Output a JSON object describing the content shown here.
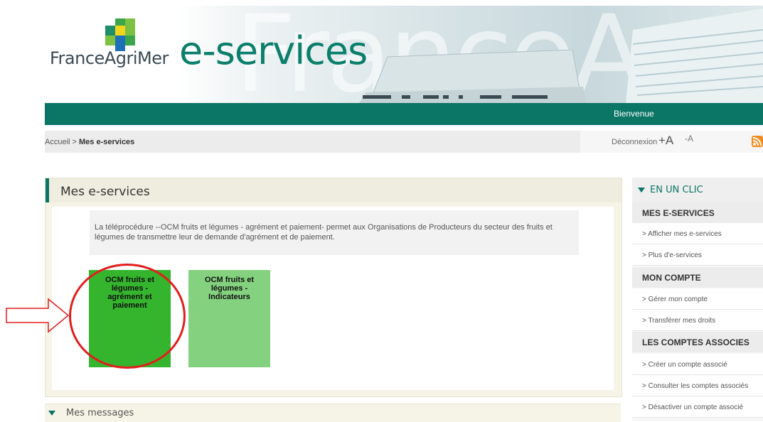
{
  "header": {
    "logo_text": "FranceAgriMer",
    "title": "e-services",
    "ghost_text": "FranceAgriMer"
  },
  "nav": {
    "welcome": "Bienvenue"
  },
  "breadcrumb": {
    "home": "Accueil",
    "separator": " > ",
    "current": "Mes e-services"
  },
  "toolbar": {
    "logout": "Déconnexion",
    "increase_font": "+A",
    "decrease_font": "-A",
    "rss_icon": "rss-icon"
  },
  "main": {
    "title": "Mes e-services",
    "description": "La téléprocédure --OCM fruits et légumes - agrément et paiement- permet aux Organisations de Producteurs du secteur des fruits et légumes de transmettre leur de demande d'agrément et de paiement.",
    "tiles": [
      {
        "label": "OCM fruits et légumes - agrément et paiement",
        "color": "#35b42e"
      },
      {
        "label": "OCM fruits et légumes - Indicateurs",
        "color": "#84d27f"
      }
    ]
  },
  "messages": {
    "label": "Mes messages"
  },
  "sidebar": {
    "heading": "EN UN CLIC",
    "sections": [
      {
        "title": "MES E-SERVICES",
        "links": [
          "> Afficher mes e-services",
          "> Plus d'e-services"
        ]
      },
      {
        "title": "MON COMPTE",
        "links": [
          "> Gérer mon compte",
          "> Transférer mes droits"
        ]
      },
      {
        "title": "LES COMPTES ASSOCIES",
        "links": [
          "> Créer un compte associé",
          "> Consulter les comptes associés",
          "> Désactiver un compte associé"
        ]
      }
    ]
  },
  "colors": {
    "brand_green": "#0b7566",
    "tile_active": "#35b42e",
    "tile_inactive": "#84d27f",
    "annotation_red": "#e21d1d"
  }
}
